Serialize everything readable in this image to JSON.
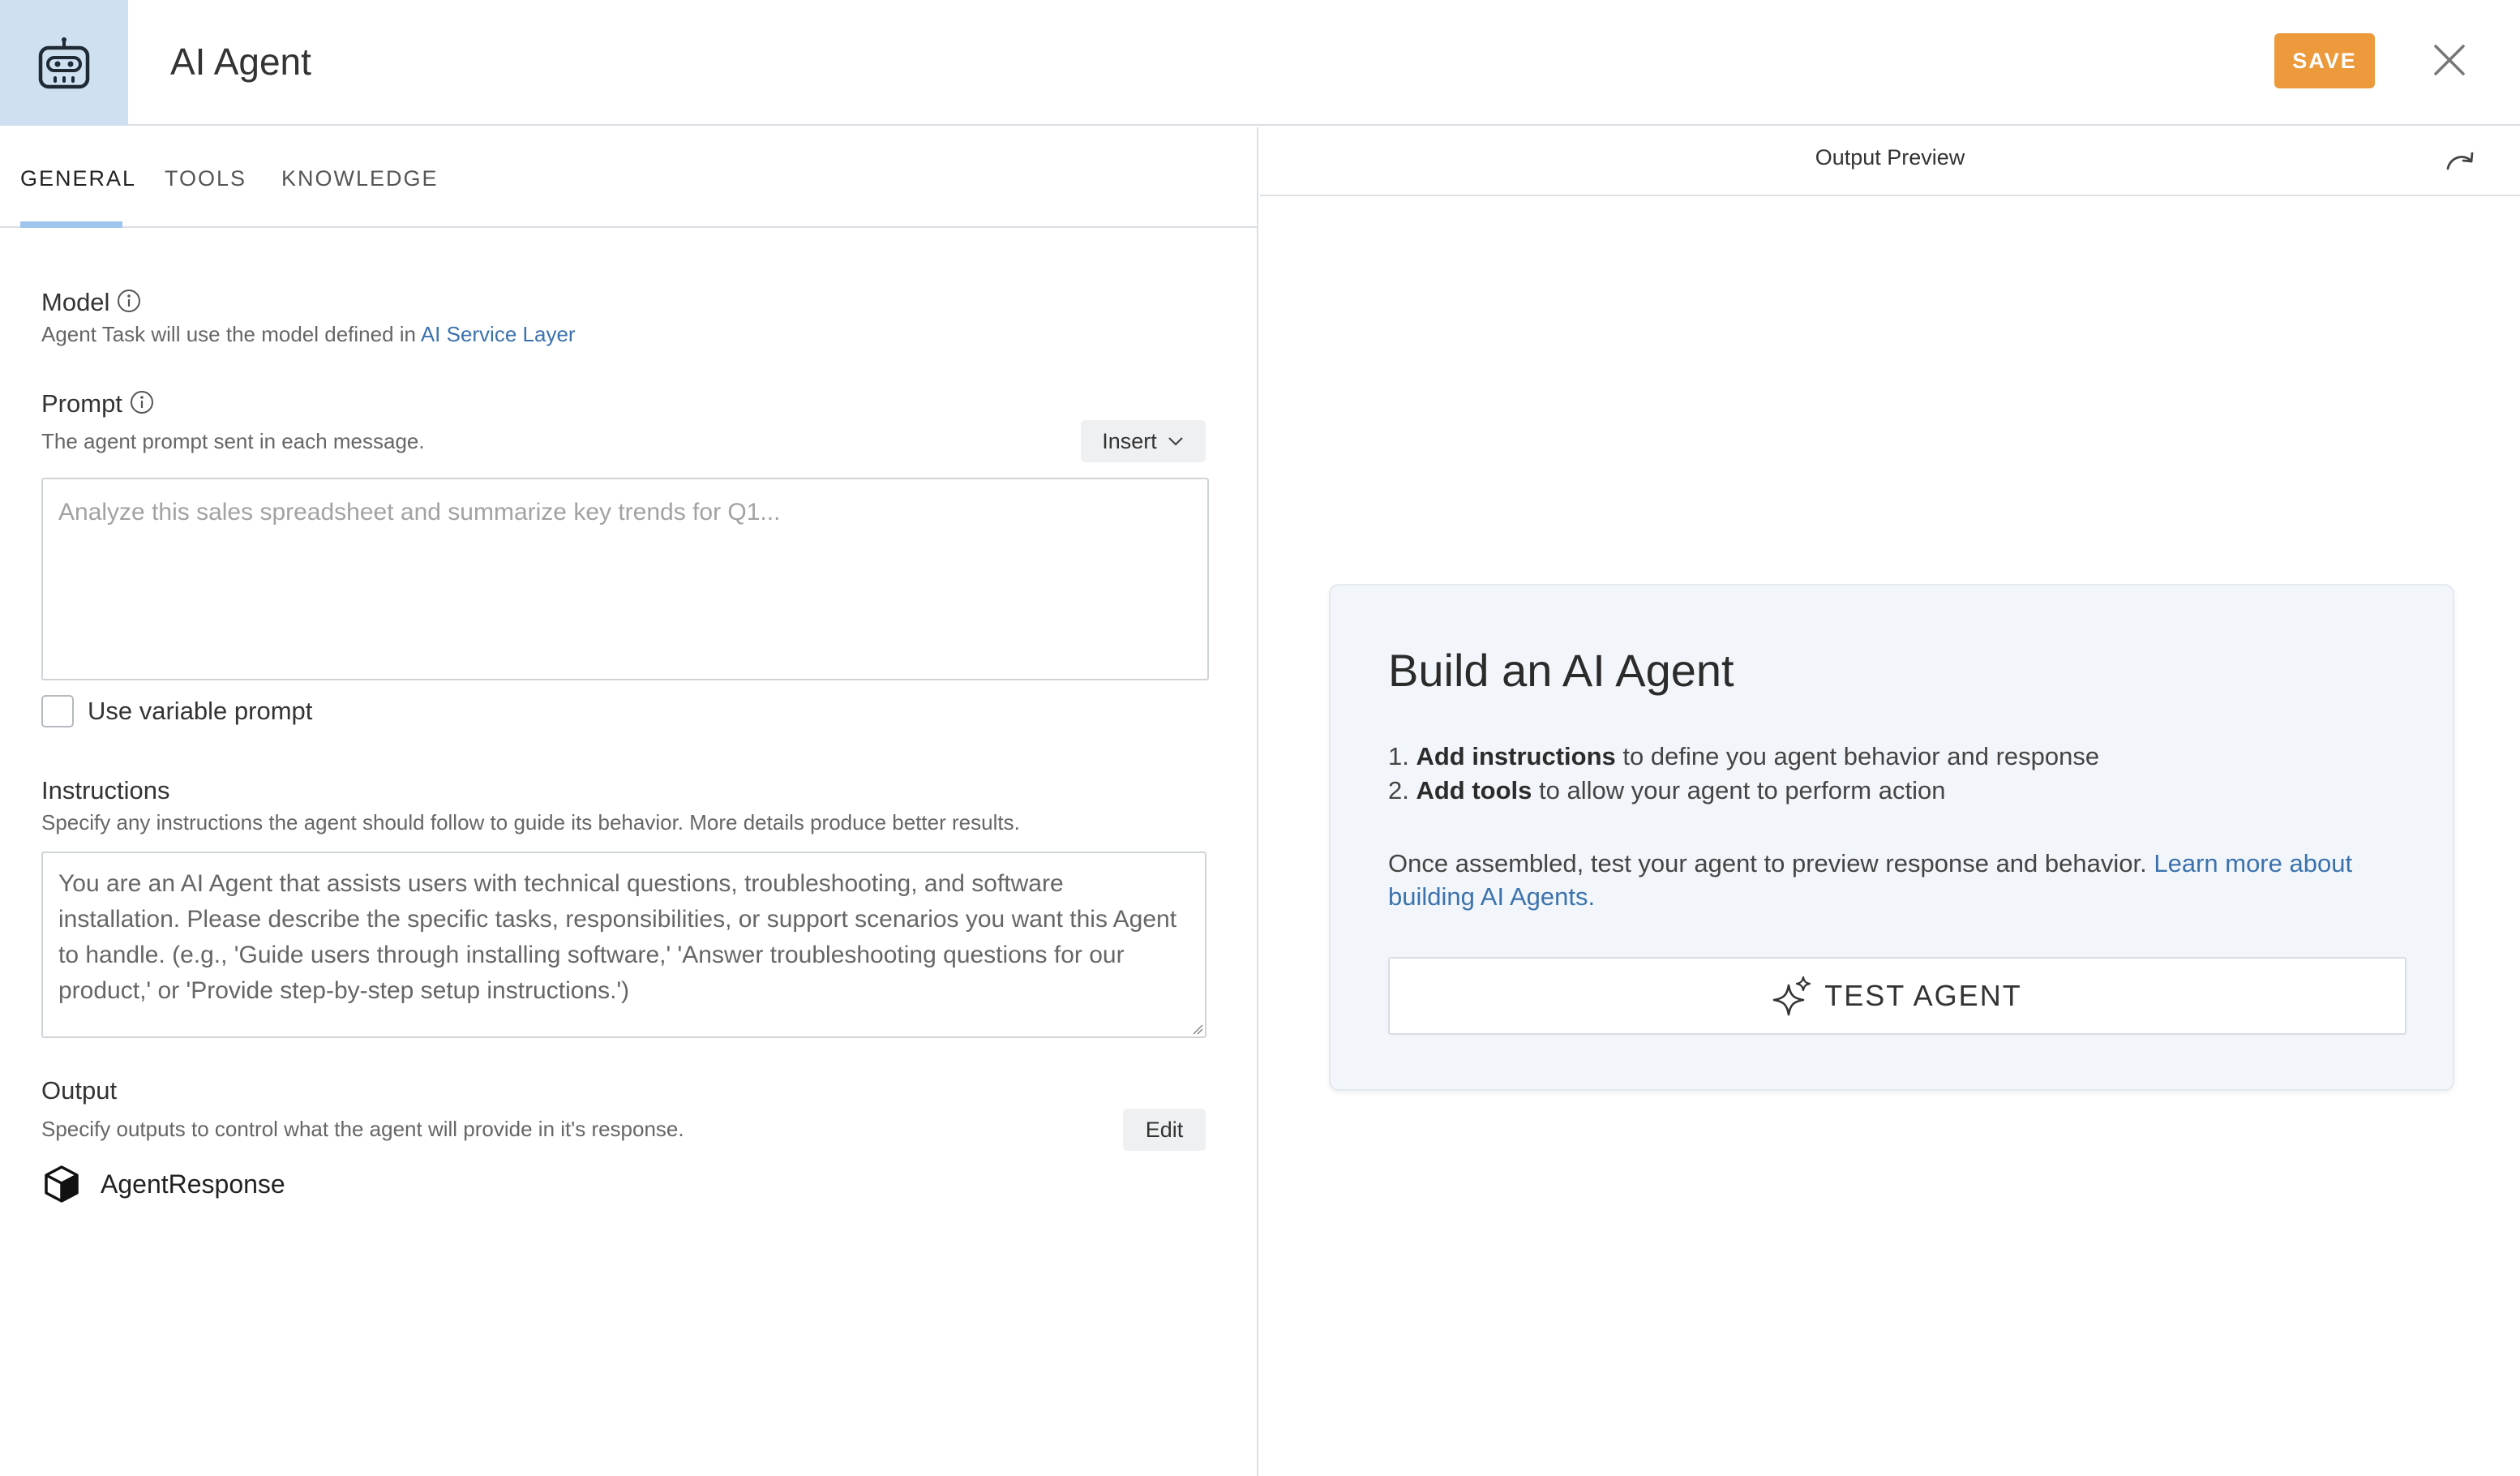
{
  "header": {
    "title": "AI Agent",
    "app_icon": "robot-icon",
    "save_label": "SAVE",
    "close_icon": "close-icon"
  },
  "tabs": [
    {
      "label": "GENERAL",
      "active": true
    },
    {
      "label": "TOOLS",
      "active": false
    },
    {
      "label": "KNOWLEDGE",
      "active": false
    }
  ],
  "model": {
    "title": "Model",
    "desc_prefix": "Agent Task will use the model defined in ",
    "desc_link": "AI Service Layer"
  },
  "prompt": {
    "title": "Prompt",
    "desc": "The agent prompt sent in each message.",
    "insert_label": "Insert",
    "placeholder": "Analyze this sales spreadsheet and summarize key trends for Q1...",
    "value": "",
    "variable_label": "Use variable prompt",
    "variable_checked": false
  },
  "instructions": {
    "title": "Instructions",
    "desc": "Specify any instructions the agent should follow to guide its behavior. More details produce better results.",
    "value": "You are an AI Agent that assists users with technical questions, troubleshooting, and software installation. Please describe the specific tasks, responsibilities, or support scenarios you want this Agent to handle. (e.g., 'Guide users through installing software,' 'Answer troubleshooting questions for our product,' or 'Provide step-by-step setup instructions.')"
  },
  "output": {
    "title": "Output",
    "desc": "Specify outputs to control what the agent will provide in it's response.",
    "edit_label": "Edit",
    "items": [
      {
        "label": "AgentResponse",
        "icon": "cube-icon"
      }
    ]
  },
  "preview": {
    "title": "Output Preview",
    "refresh_icon": "redo-icon",
    "card": {
      "title": "Build an AI Agent",
      "steps": [
        {
          "num": "1.",
          "bold": "Add instructions",
          "rest": " to define you agent behavior and response"
        },
        {
          "num": "2.",
          "bold": "Add tools",
          "rest": " to allow your agent to perform action"
        }
      ],
      "text": "Once assembled, test your agent to preview response and behavior. ",
      "link": "Learn more about building AI Agents.",
      "button_label": "TEST AGENT",
      "button_icon": "sparkle-icon"
    }
  },
  "colors": {
    "accent": "#ec9a3c",
    "link": "#3b72ad",
    "icon_box": "#cfe0f1",
    "tab_underline": "#9fc5ec"
  }
}
